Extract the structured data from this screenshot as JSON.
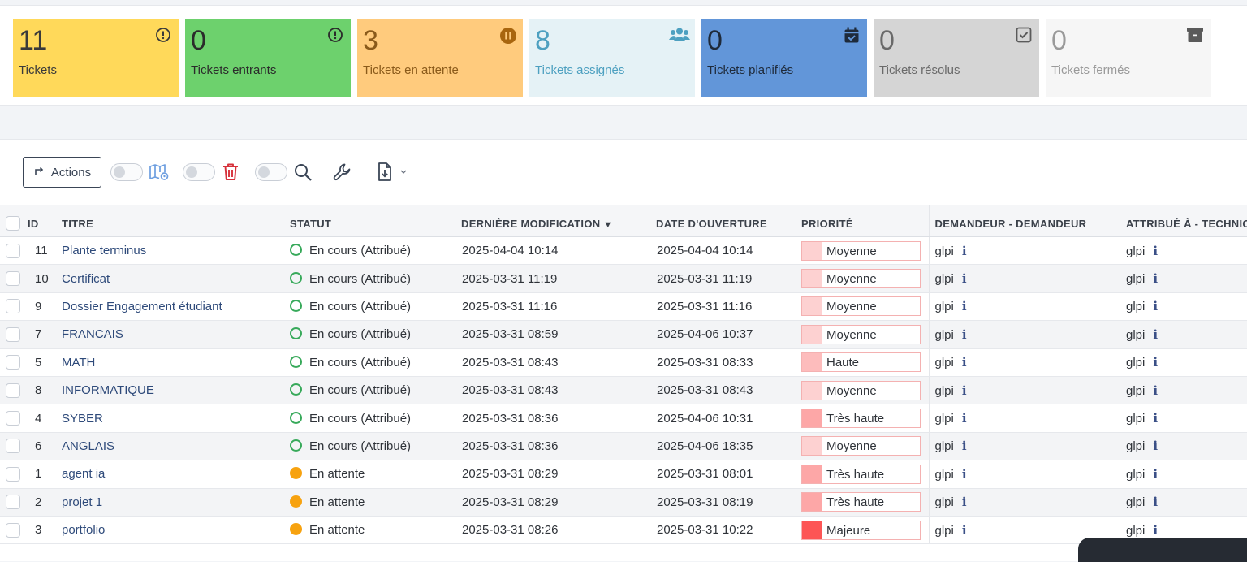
{
  "cards": [
    {
      "count": "11",
      "label": "Tickets",
      "bg": "#ffd95a",
      "fg": "#3a3a3a",
      "icon": "alert-circle-icon"
    },
    {
      "count": "0",
      "label": "Tickets entrants",
      "bg": "#6dd16d",
      "fg": "#2b2b2b",
      "icon": "alert-circle-icon"
    },
    {
      "count": "3",
      "label": "Tickets en attente",
      "bg": "#ffcb7d",
      "fg": "#8a5a1a",
      "icon": "pause-circle-icon"
    },
    {
      "count": "8",
      "label": "Tickets assignés",
      "bg": "#e5f2f6",
      "fg": "#4da0c0",
      "icon": "users-icon"
    },
    {
      "count": "0",
      "label": "Tickets planifiés",
      "bg": "#6296d9",
      "fg": "#1e2a3a",
      "icon": "calendar-check-icon"
    },
    {
      "count": "0",
      "label": "Tickets résolus",
      "bg": "#d5d5d5",
      "fg": "#6a6a6a",
      "icon": "checkbox-icon"
    },
    {
      "count": "0",
      "label": "Tickets fermés",
      "bg": "#f6f6f6",
      "fg": "#9a9a9a",
      "icon": "archive-icon"
    }
  ],
  "toolbar": {
    "actions_label": "Actions"
  },
  "columns": [
    "",
    "ID",
    "TITRE",
    "STATUT",
    "DERNIÈRE MODIFICATION",
    "DATE D'OUVERTURE",
    "PRIORITÉ",
    "DEMANDEUR - DEMANDEUR",
    "ATTRIBUÉ À - TECHNIC"
  ],
  "sort_indicator": "▼",
  "priority_colors": {
    "Moyenne": "#fdd1d1",
    "Haute": "#fdbcbc",
    "Très haute": "#fda7a7",
    "Majeure": "#fd5555"
  },
  "status_styles": {
    "En cours (Attribué)": "ring-green",
    "En attente": "dot-orange"
  },
  "rows": [
    {
      "id": "11",
      "title": "Plante terminus",
      "status": "En cours (Attribué)",
      "modified": "2025-04-04 10:14",
      "opened": "2025-04-04 10:14",
      "priority": "Moyenne",
      "requester": "glpi",
      "assigned": "glpi"
    },
    {
      "id": "10",
      "title": "Certificat",
      "status": "En cours (Attribué)",
      "modified": "2025-03-31 11:19",
      "opened": "2025-03-31 11:19",
      "priority": "Moyenne",
      "requester": "glpi",
      "assigned": "glpi"
    },
    {
      "id": "9",
      "title": "Dossier Engagement étudiant",
      "status": "En cours (Attribué)",
      "modified": "2025-03-31 11:16",
      "opened": "2025-03-31 11:16",
      "priority": "Moyenne",
      "requester": "glpi",
      "assigned": "glpi"
    },
    {
      "id": "7",
      "title": "FRANCAIS",
      "status": "En cours (Attribué)",
      "modified": "2025-03-31 08:59",
      "opened": "2025-04-06 10:37",
      "priority": "Moyenne",
      "requester": "glpi",
      "assigned": "glpi"
    },
    {
      "id": "5",
      "title": "MATH",
      "status": "En cours (Attribué)",
      "modified": "2025-03-31 08:43",
      "opened": "2025-03-31 08:33",
      "priority": "Haute",
      "requester": "glpi",
      "assigned": "glpi"
    },
    {
      "id": "8",
      "title": "INFORMATIQUE",
      "status": "En cours (Attribué)",
      "modified": "2025-03-31 08:43",
      "opened": "2025-03-31 08:43",
      "priority": "Moyenne",
      "requester": "glpi",
      "assigned": "glpi"
    },
    {
      "id": "4",
      "title": "SYBER",
      "status": "En cours (Attribué)",
      "modified": "2025-03-31 08:36",
      "opened": "2025-04-06 10:31",
      "priority": "Très haute",
      "requester": "glpi",
      "assigned": "glpi"
    },
    {
      "id": "6",
      "title": "ANGLAIS",
      "status": "En cours (Attribué)",
      "modified": "2025-03-31 08:36",
      "opened": "2025-04-06 18:35",
      "priority": "Moyenne",
      "requester": "glpi",
      "assigned": "glpi"
    },
    {
      "id": "1",
      "title": "agent ia",
      "status": "En attente",
      "modified": "2025-03-31 08:29",
      "opened": "2025-03-31 08:01",
      "priority": "Très haute",
      "requester": "glpi",
      "assigned": "glpi"
    },
    {
      "id": "2",
      "title": "projet 1",
      "status": "En attente",
      "modified": "2025-03-31 08:29",
      "opened": "2025-03-31 08:19",
      "priority": "Très haute",
      "requester": "glpi",
      "assigned": "glpi"
    },
    {
      "id": "3",
      "title": "portfolio",
      "status": "En attente",
      "modified": "2025-03-31 08:26",
      "opened": "2025-03-31 10:22",
      "priority": "Majeure",
      "requester": "glpi",
      "assigned": "glpi"
    }
  ]
}
